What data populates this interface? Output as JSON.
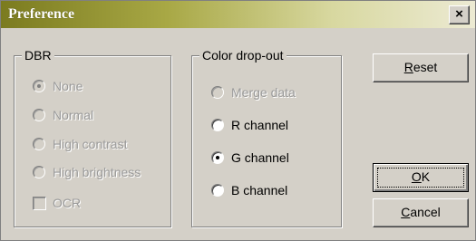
{
  "window": {
    "title": "Preference",
    "close_glyph": "×"
  },
  "dbr": {
    "legend": "DBR",
    "options": [
      {
        "label": "None",
        "selected": true,
        "enabled": false
      },
      {
        "label": "Normal",
        "selected": false,
        "enabled": false
      },
      {
        "label": "High contrast",
        "selected": false,
        "enabled": false
      },
      {
        "label": "High brightness",
        "selected": false,
        "enabled": false
      }
    ],
    "ocr": {
      "label": "OCR",
      "checked": false,
      "enabled": false
    }
  },
  "color_dropout": {
    "legend": "Color drop-out",
    "options": [
      {
        "label": "Merge data",
        "selected": false,
        "enabled": false
      },
      {
        "label": "R channel",
        "selected": false,
        "enabled": true
      },
      {
        "label": "G channel",
        "selected": true,
        "enabled": true
      },
      {
        "label": "B channel",
        "selected": false,
        "enabled": true
      }
    ]
  },
  "buttons": {
    "reset": {
      "first": "R",
      "rest": "eset"
    },
    "ok": {
      "first": "O",
      "rest": "K"
    },
    "cancel": {
      "first": "C",
      "rest": "ancel"
    }
  },
  "colors": {
    "dialog_face": "#d4d0c8",
    "title_gradient_start": "#7b7b1f",
    "title_gradient_end": "#ecead3",
    "disabled_text": "#9a9a9a"
  }
}
